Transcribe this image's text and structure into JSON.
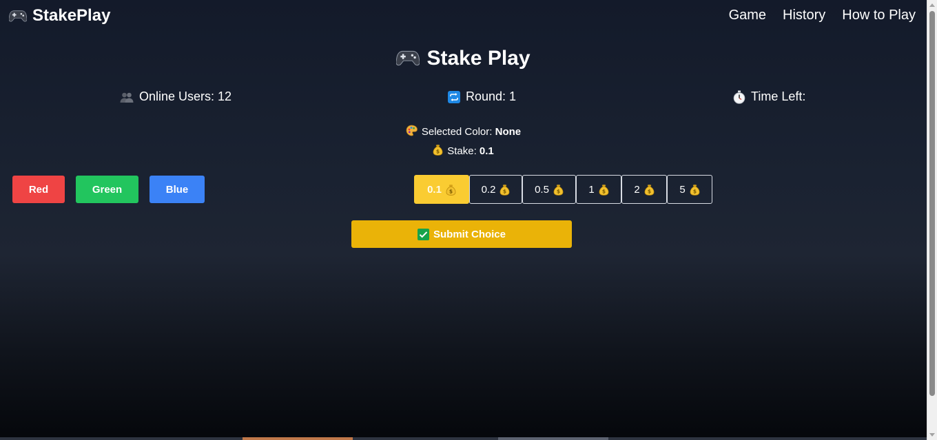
{
  "navbar": {
    "brand": "StakePlay",
    "links": [
      "Game",
      "History",
      "How to Play"
    ]
  },
  "main": {
    "title": "Stake Play",
    "online_users": "Online Users: 12",
    "round": "Round: 1",
    "time_left": "Time Left:",
    "selected_color_label": "Selected Color:",
    "selected_color_value": "None",
    "stake_label": "Stake:",
    "stake_value": "0.1"
  },
  "colors": [
    {
      "label": "Red",
      "hex": "#ef4444"
    },
    {
      "label": "Green",
      "hex": "#22c55e"
    },
    {
      "label": "Blue",
      "hex": "#3b82f6"
    }
  ],
  "stakes": [
    "0.1",
    "0.2",
    "0.5",
    "1",
    "2",
    "5"
  ],
  "selected_stake": "0.1",
  "submit_label": "Submit Choice",
  "icons": {
    "brand": "gamepad-icon",
    "title": "gamepad-icon",
    "users": "users-icon",
    "round": "repeat-icon",
    "time": "stopwatch-icon",
    "palette": "palette-icon",
    "stake": "money-bag-icon",
    "submit": "check-box-icon"
  },
  "theme": {
    "accent": "#eab308",
    "active_stake": "#facc32"
  }
}
